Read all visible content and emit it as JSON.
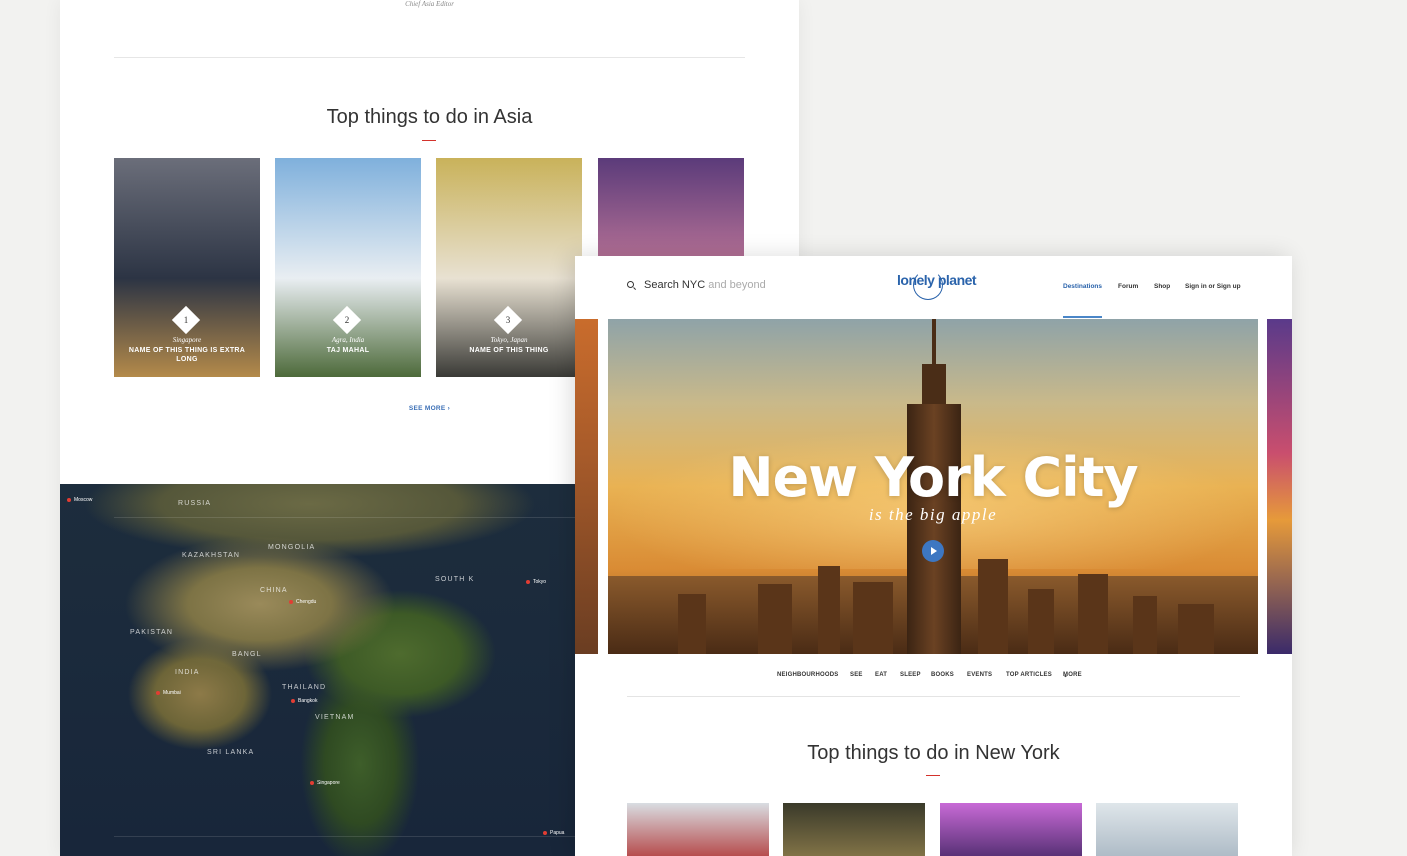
{
  "asia_page": {
    "caption": "Chief Asia Editor",
    "section_title": "Top things to do in Asia",
    "cards": [
      {
        "rank": "1",
        "location": "Singapore",
        "name": "NAME OF THIS THING IS EXTRA LONG",
        "colors": [
          "#6b6e7a",
          "#2c3444",
          "#b48a4a"
        ]
      },
      {
        "rank": "2",
        "location": "Agra, India",
        "name": "TAJ MAHAL",
        "colors": [
          "#7fb0dc",
          "#e9eef2",
          "#4d6a3a"
        ]
      },
      {
        "rank": "3",
        "location": "Tokyo, Japan",
        "name": "NAME OF THIS THING",
        "colors": [
          "#c9b25a",
          "#e8e1d2",
          "#3a3a36"
        ]
      },
      {
        "rank": "",
        "location": "",
        "name": "",
        "colors": [
          "#5b3b7a",
          "#c47a9a",
          "#2a2f4a"
        ]
      }
    ],
    "see_more": "SEE MORE",
    "map": {
      "regions": [
        "RUSSIA",
        "KAZAKHSTAN",
        "MONGOLIA",
        "CHINA",
        "PAKISTAN",
        "INDIA",
        "BANGL",
        "THAILAND",
        "SOUTH K",
        "VIETNAM",
        "SRI LANKA"
      ],
      "cities": [
        "Moscow",
        "Tokyo",
        "Chengdu",
        "Mumbai",
        "Bangkok",
        "Singapore",
        "Papua"
      ]
    }
  },
  "nyc_page": {
    "search": {
      "label": "Search NYC",
      "placeholder": "and beyond"
    },
    "logo": "lonely planet",
    "nav": [
      "Destinations",
      "Forum",
      "Shop",
      "Sign in or Sign up"
    ],
    "hero": {
      "title": "New York City",
      "subtitle": "is the big apple"
    },
    "subnav": [
      "NEIGHBOURHOODS",
      "SEE",
      "EAT",
      "SLEEP",
      "BOOKS",
      "EVENTS",
      "TOP ARTICLES",
      "MORE"
    ],
    "section_title": "Top things to do in New York",
    "cards": [
      {
        "colors": [
          "#d9dde2",
          "#b23a3a"
        ]
      },
      {
        "colors": [
          "#3a3a2a",
          "#8a7a4a"
        ]
      },
      {
        "colors": [
          "#c86ad6",
          "#4a2a6a"
        ]
      },
      {
        "colors": [
          "#dfe6ea",
          "#a8b6c2"
        ]
      }
    ]
  }
}
